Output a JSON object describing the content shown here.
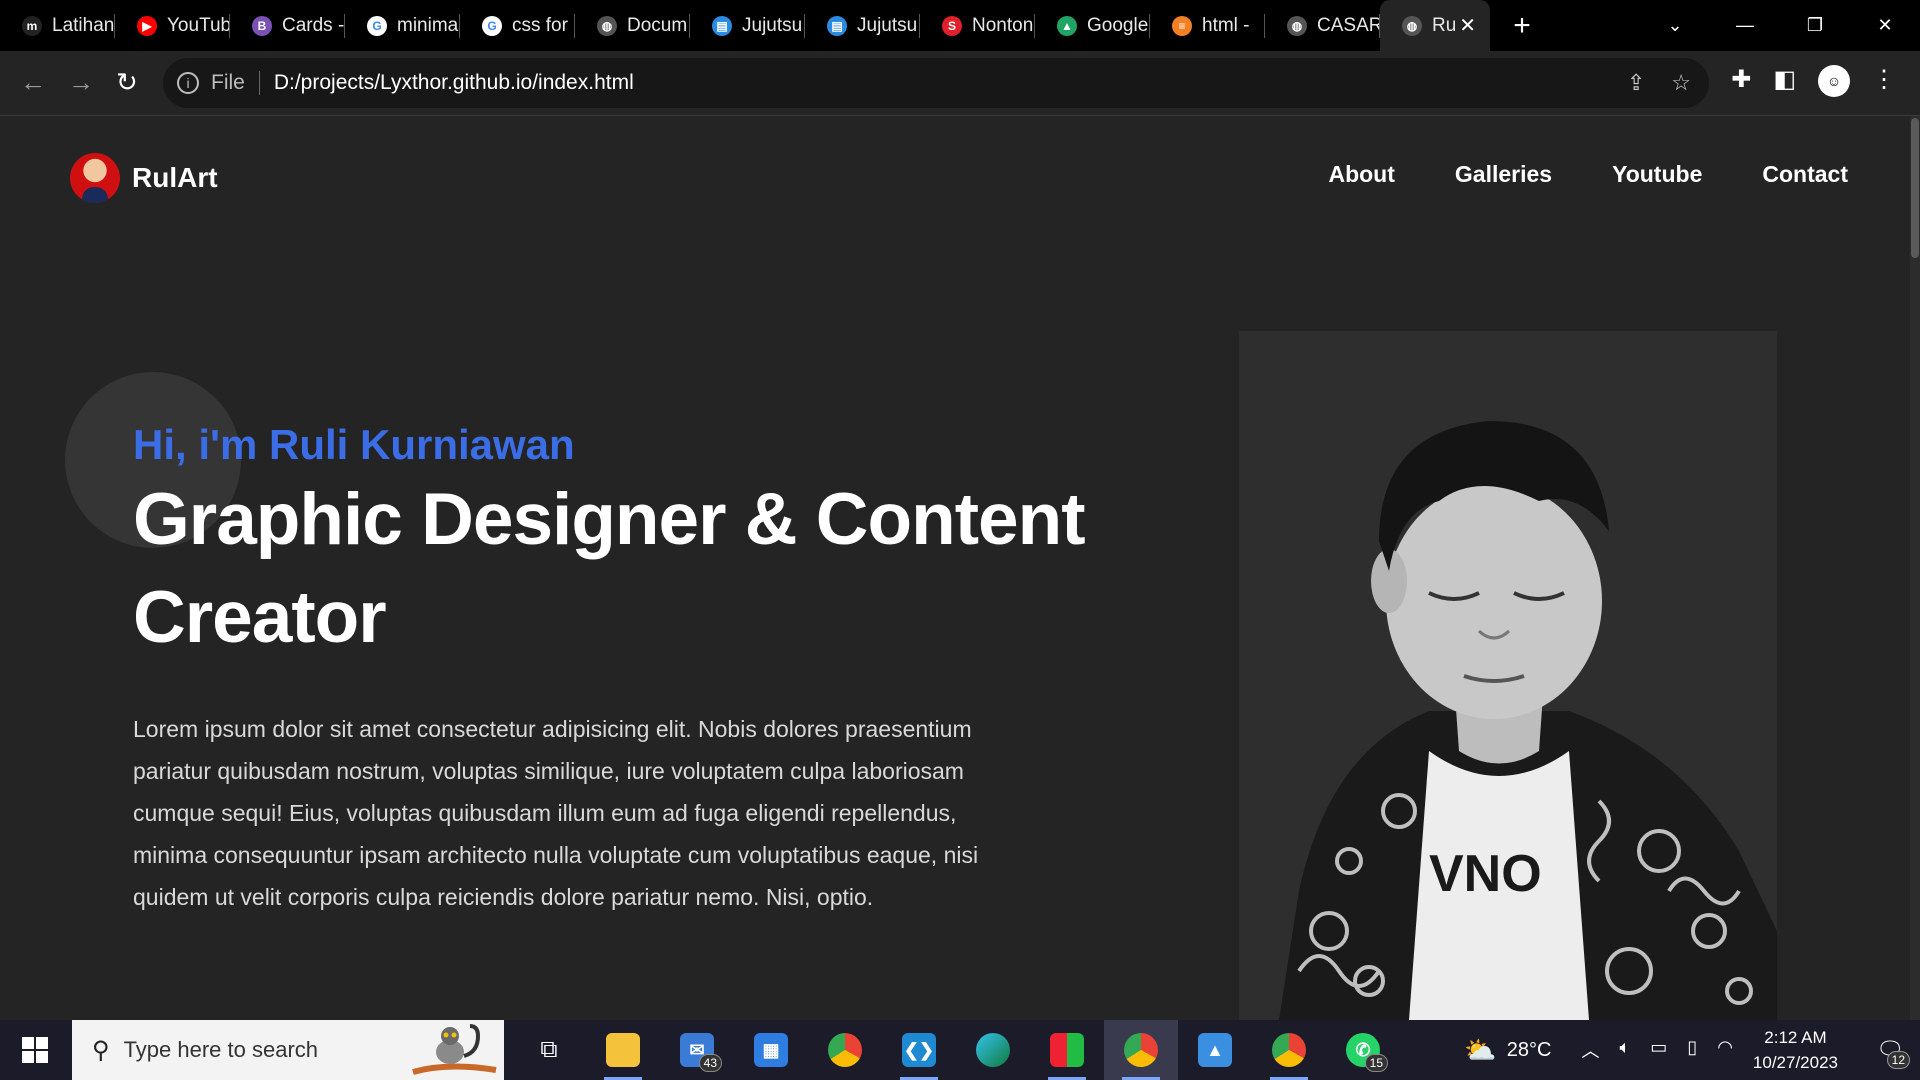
{
  "browser": {
    "tabs": [
      {
        "title": "Latihan",
        "icon": "m-favicon-icon",
        "color": "#222222"
      },
      {
        "title": "YouTube",
        "icon": "youtube-icon",
        "color": "#ff0000"
      },
      {
        "title": "Cards -",
        "icon": "bootstrap-icon",
        "color": "#7952b3"
      },
      {
        "title": "minima",
        "icon": "google-icon",
        "color": "#ffffff"
      },
      {
        "title": "css for",
        "icon": "google-icon",
        "color": "#ffffff"
      },
      {
        "title": "Docum",
        "icon": "globe-icon",
        "color": "#555555"
      },
      {
        "title": "Jujutsu",
        "icon": "manga-icon",
        "color": "#2a8be0"
      },
      {
        "title": "Jujutsu",
        "icon": "manga-icon",
        "color": "#2a8be0"
      },
      {
        "title": "Nonton",
        "icon": "s-favicon-icon",
        "color": "#e0202a"
      },
      {
        "title": "Google",
        "icon": "google-drive-icon",
        "color": "#1fa463"
      },
      {
        "title": "html - ",
        "icon": "stackoverflow-icon",
        "color": "#f48024"
      },
      {
        "title": "CASAR",
        "icon": "globe-icon",
        "color": "#555555"
      }
    ],
    "active_tab": {
      "title": "Ru",
      "close": "✕"
    },
    "new_tab": "+",
    "address": {
      "scheme_label": "File",
      "url": "D:/projects/Lyxthor.github.io/index.html"
    }
  },
  "site": {
    "brand": "RulArt",
    "nav": [
      "About",
      "Galleries",
      "Youtube",
      "Contact"
    ],
    "greeting": "Hi, i'm Ruli Kurniawan",
    "headline": "Graphic Designer & Content Creator",
    "paragraph": "Lorem ipsum dolor sit amet consectetur adipisicing elit. Nobis dolores praesentium pariatur quibusdam nostrum, voluptas similique, iure voluptatem culpa laboriosam cumque sequi! Eius, voluptas quibusdam illum eum ad fuga eligendi repellendus, minima consequuntur ipsam architecto nulla voluptate cum voluptatibus eaque, nisi quidem ut velit corporis culpa reiciendis dolore pariatur nemo. Nisi, optio.",
    "shirt_text": "VNO",
    "accent_color": "#3b6ee6"
  },
  "taskbar": {
    "search_placeholder": "Type here to search",
    "mail_badge": "43",
    "whatsapp_badge": "15",
    "temperature": "28°C",
    "time": "2:12 AM",
    "date": "10/27/2023",
    "notification_count": "12"
  }
}
